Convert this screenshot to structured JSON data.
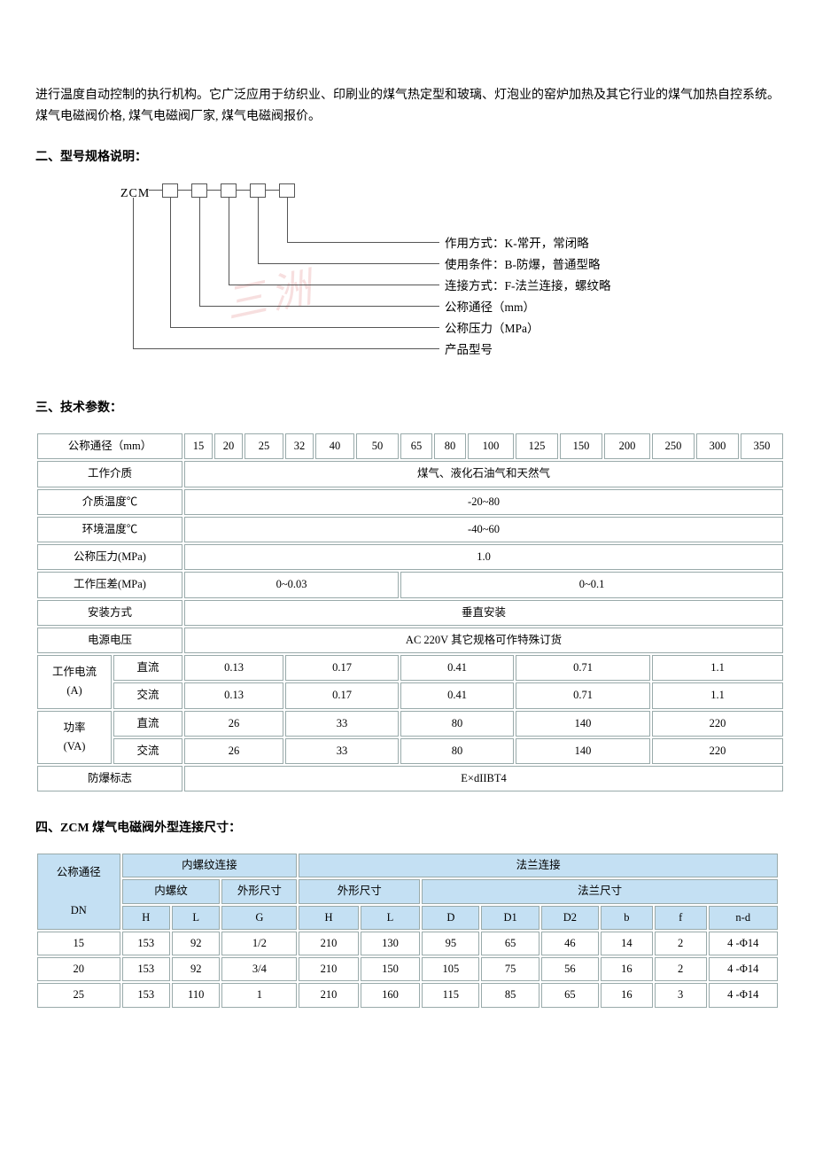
{
  "intro_paragraph": "进行温度自动控制的执行机构。它广泛应用于纺织业、印刷业的煤气热定型和玻璃、灯泡业的窑炉加热及其它行业的煤气加热自控系统。  煤气电磁阀价格, 煤气电磁阀厂家, 煤气电磁阀报价。",
  "sections": {
    "s2": "二、型号规格说明：",
    "s3": "三、技术参数：",
    "s4": "四、ZCM 煤气电磁阀外型连接尺寸："
  },
  "diagram": {
    "prefix": "ZCM",
    "labels": [
      "作用方式：K-常开，常闭略",
      "使用条件：B-防爆，普通型略",
      "连接方式：F-法兰连接，螺纹略",
      "公称通径（mm）",
      "公称压力（MPa）",
      "产品型号"
    ],
    "watermark": "三洲"
  },
  "tech_table": {
    "row_dn_label": "公称通径（mm）",
    "dn": [
      "15",
      "20",
      "25",
      "32",
      "40",
      "50",
      "65",
      "80",
      "100",
      "125",
      "150",
      "200",
      "250",
      "300",
      "350"
    ],
    "media_label": "工作介质",
    "media_val": "煤气、液化石油气和天然气",
    "mtemp_label": "介质温度℃",
    "mtemp_val": "-20~80",
    "etemp_label": "环境温度℃",
    "etemp_val": "-40~60",
    "pn_label": "公称压力(MPa)",
    "pn_val": "1.0",
    "dp_label": "工作压差(MPa)",
    "dp_vals": [
      "0~0.03",
      "0~0.1"
    ],
    "install_label": "安装方式",
    "install_val": "垂直安装",
    "power_label": "电源电压",
    "power_val": "AC 220V 其它规格可作特殊订货",
    "cur_label": "工作电流",
    "cur_unit": "(A)",
    "dc": "直流",
    "ac": "交流",
    "cur_vals": [
      "0.13",
      "0.17",
      "0.41",
      "0.71",
      "1.1"
    ],
    "pow_label": "功率",
    "pow_unit": "(VA)",
    "pow_vals": [
      "26",
      "33",
      "80",
      "140",
      "220"
    ],
    "ex_label": "防爆标志",
    "ex_val": "E×dIIBT4"
  },
  "conn_table": {
    "dn_label_1": "公称通径",
    "dn_label_2": "DN",
    "thread_group": "内螺纹连接",
    "flange_group": "法兰连接",
    "thread_sub": "内螺纹",
    "outline_sub": "外形尺寸",
    "flange_sub": "法兰尺寸",
    "cols": [
      "H",
      "L",
      "G",
      "H",
      "L",
      "D",
      "D1",
      "D2",
      "b",
      "f",
      "n-d"
    ],
    "rows": [
      [
        "15",
        "153",
        "92",
        "1/2",
        "210",
        "130",
        "95",
        "65",
        "46",
        "14",
        "2",
        "4 -Φ14"
      ],
      [
        "20",
        "153",
        "92",
        "3/4",
        "210",
        "150",
        "105",
        "75",
        "56",
        "16",
        "2",
        "4 -Φ14"
      ],
      [
        "25",
        "153",
        "110",
        "1",
        "210",
        "160",
        "115",
        "85",
        "65",
        "16",
        "3",
        "4 -Φ14"
      ]
    ]
  }
}
